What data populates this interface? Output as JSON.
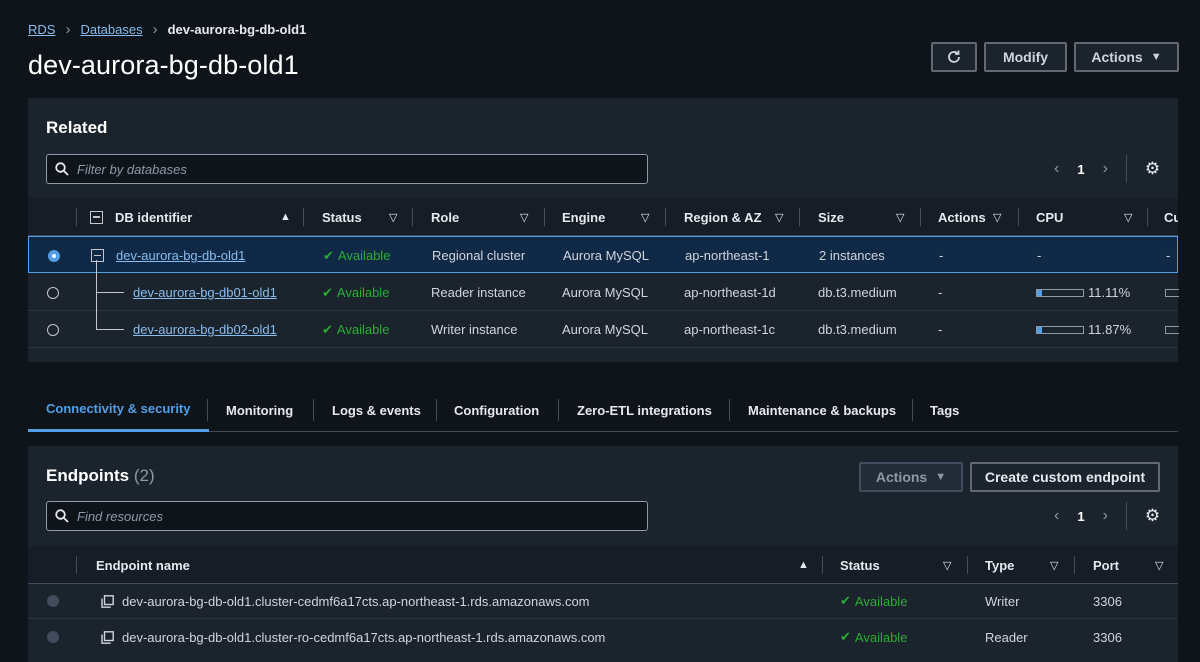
{
  "breadcrumb": {
    "root": "RDS",
    "parent": "Databases",
    "current": "dev-aurora-bg-db-old1"
  },
  "page": {
    "title": "dev-aurora-bg-db-old1"
  },
  "header_buttons": {
    "modify": "Modify",
    "actions": "Actions"
  },
  "related": {
    "title": "Related",
    "search_placeholder": "Filter by databases",
    "page": "1",
    "columns": [
      "DB identifier",
      "Status",
      "Role",
      "Engine",
      "Region & AZ",
      "Size",
      "Actions",
      "CPU",
      "Cu"
    ],
    "rows": [
      {
        "id": "dev-aurora-bg-db-old1",
        "status": "Available",
        "role": "Regional cluster",
        "engine": "Aurora MySQL",
        "region": "ap-northeast-1",
        "size": "2 instances",
        "actions": "-",
        "cpu": "-",
        "cu": "-",
        "cpu_fraction": null
      },
      {
        "id": "dev-aurora-bg-db01-old1",
        "status": "Available",
        "role": "Reader instance",
        "engine": "Aurora MySQL",
        "region": "ap-northeast-1d",
        "size": "db.t3.medium",
        "actions": "-",
        "cpu": "11.11%",
        "cu": "",
        "cpu_fraction": 0.1111
      },
      {
        "id": "dev-aurora-bg-db02-old1",
        "status": "Available",
        "role": "Writer instance",
        "engine": "Aurora MySQL",
        "region": "ap-northeast-1c",
        "size": "db.t3.medium",
        "actions": "-",
        "cpu": "11.87%",
        "cu": "",
        "cpu_fraction": 0.1187
      }
    ]
  },
  "tabs": [
    "Connectivity & security",
    "Monitoring",
    "Logs & events",
    "Configuration",
    "Zero-ETL integrations",
    "Maintenance & backups",
    "Tags"
  ],
  "endpoints": {
    "title": "Endpoints",
    "count": "(2)",
    "actions_label": "Actions",
    "create_label": "Create custom endpoint",
    "search_placeholder": "Find resources",
    "page": "1",
    "columns": [
      "Endpoint name",
      "Status",
      "Type",
      "Port"
    ],
    "rows": [
      {
        "name": "dev-aurora-bg-db-old1.cluster-cedmf6a17cts.ap-northeast-1.rds.amazonaws.com",
        "status": "Available",
        "type": "Writer",
        "port": "3306"
      },
      {
        "name": "dev-aurora-bg-db-old1.cluster-ro-cedmf6a17cts.ap-northeast-1.rds.amazonaws.com",
        "status": "Available",
        "type": "Reader",
        "port": "3306"
      }
    ]
  },
  "colors": {
    "accent": "#539fe5",
    "link": "#89bdee",
    "success": "#29ad32",
    "background": "#0f141a",
    "panel": "#1b232d"
  }
}
